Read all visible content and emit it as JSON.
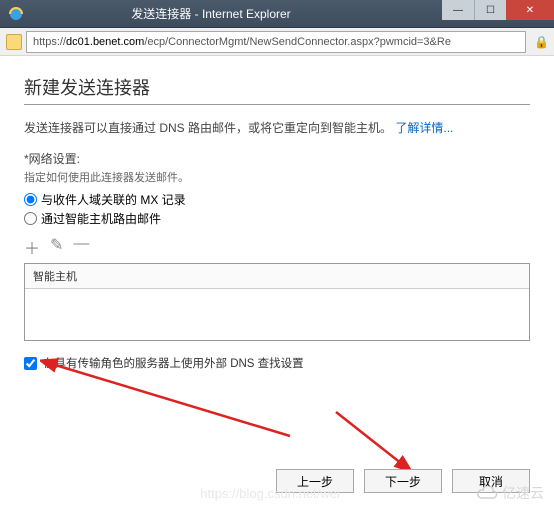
{
  "window": {
    "title": "发送连接器 - Internet Explorer"
  },
  "addressbar": {
    "url_prefix": "https://",
    "url_host": "dc01.benet.com",
    "url_path": "/ecp/ConnectorMgmt/NewSendConnector.aspx?pwmcid=3&Re"
  },
  "page": {
    "title": "新建发送连接器",
    "intro_text": "发送连接器可以直接通过 DNS 路由邮件，或将它重定向到智能主机。",
    "learn_more": "了解详情...",
    "network_label": "*网络设置:",
    "network_sub": "指定如何使用此连接器发送邮件。",
    "radio_mx": "与收件人域关联的 MX 记录",
    "radio_smarthost": "通过智能主机路由邮件",
    "list_header": "智能主机",
    "checkbox_label": "在具有传输角色的服务器上使用外部 DNS 查找设置",
    "toolbar": {
      "add": "＋",
      "edit": "✎",
      "remove": "—"
    }
  },
  "footer": {
    "back": "上一步",
    "next": "下一步",
    "cancel": "取消"
  },
  "watermark": {
    "brand": "亿速云",
    "url": "https://blog.csdn.net/wei"
  }
}
